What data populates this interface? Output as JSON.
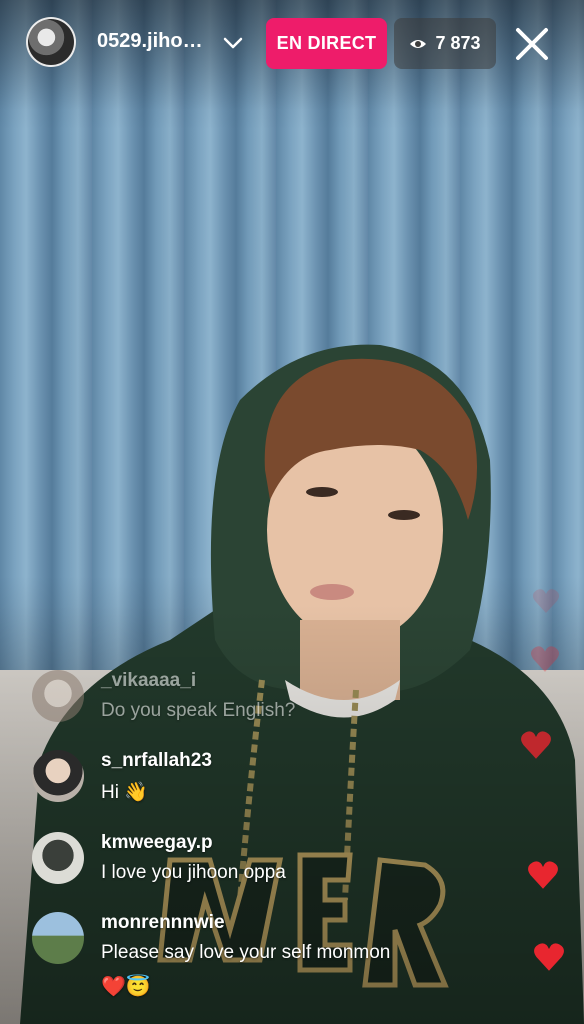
{
  "header": {
    "host_name": "0529.jiho…",
    "live_label": "EN DIRECT",
    "viewer_count": "7 873"
  },
  "comments": [
    {
      "user": "_vikaaaa_i",
      "text": "Do you speak English?"
    },
    {
      "user": "s_nrfallah23",
      "text": "Hi 👋"
    },
    {
      "user": "kmweegay.p",
      "text": "I love you jihoon oppa"
    },
    {
      "user": "monrennnwie",
      "text": "Please say love your self monmon",
      "extra": "❤️😇"
    }
  ],
  "icons": {
    "chevron": "chevron-down-icon",
    "viewers": "eye-icon",
    "close": "close-icon",
    "reaction": "heart-icon"
  },
  "colors": {
    "live_badge": "#ee1c6a",
    "heart": "#e8262f"
  }
}
